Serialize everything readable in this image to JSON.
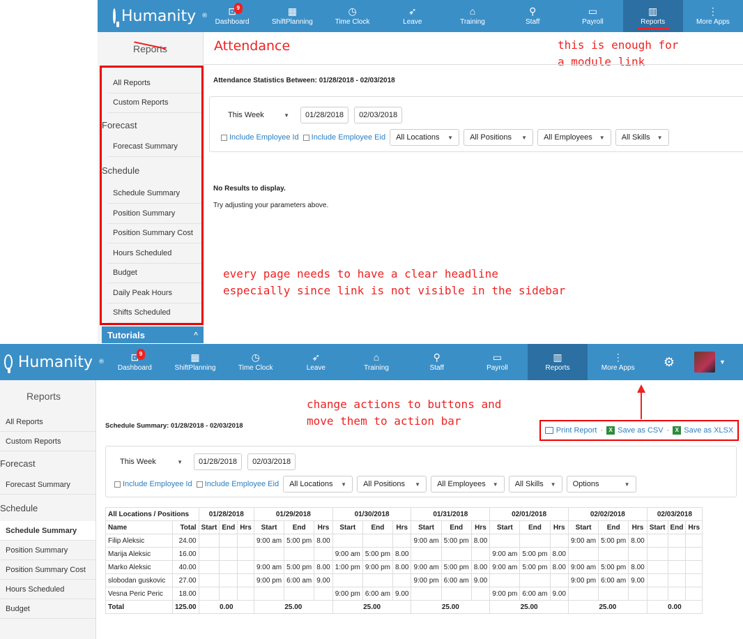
{
  "top": {
    "brand": "Humanity",
    "brand_mark": "®",
    "nav": [
      {
        "label": "Dashboard",
        "icon": "dashboard-icon",
        "glyph": "⊡",
        "badge": "9"
      },
      {
        "label": "ShiftPlanning",
        "icon": "grid-icon",
        "glyph": "▦"
      },
      {
        "label": "Time Clock",
        "icon": "clock-icon",
        "glyph": "◷"
      },
      {
        "label": "Leave",
        "icon": "rocket-icon",
        "glyph": "➶"
      },
      {
        "label": "Training",
        "icon": "graduation-cap-icon",
        "glyph": "⌂"
      },
      {
        "label": "Staff",
        "icon": "person-icon",
        "glyph": "⚲"
      },
      {
        "label": "Payroll",
        "icon": "wallet-icon",
        "glyph": "▭"
      },
      {
        "label": "Reports",
        "icon": "bar-chart-icon",
        "glyph": "▥"
      },
      {
        "label": "More Apps",
        "icon": "more-icon",
        "glyph": "⋮"
      }
    ],
    "sidebar_title": "Reports",
    "page_heading": "Attendance",
    "stats_label": "Attendance Statistics Between:  01/28/2018  -  02/03/2018",
    "range": "This Week",
    "date_from": "01/28/2018",
    "date_to": "02/03/2018",
    "chk_id": "Include Employee Id",
    "chk_eid": "Include Employee Eid",
    "filters": [
      "All Locations",
      "All Positions",
      "All Employees",
      "All Skills"
    ],
    "no_results": "No Results to display.",
    "hint": "Try adjusting your parameters above.",
    "sidebar_items": [
      "All Reports",
      "Custom Reports"
    ],
    "forecast": "Forecast",
    "forecast_items": [
      "Forecast Summary"
    ],
    "schedule": "Schedule",
    "schedule_items": [
      "Schedule Summary",
      "Position Summary",
      "Position Summary Cost",
      "Hours Scheduled",
      "Budget",
      "Daily Peak Hours",
      "Shifts Scheduled"
    ],
    "tutorials": "Tutorials",
    "note_module": [
      "this is enough for",
      "a module link"
    ],
    "note_headline": [
      "every page needs to have a clear headline",
      "especially since link is not visible in the sidebar"
    ]
  },
  "bottom": {
    "sidebar_title": "Reports",
    "sidebar_items": [
      "All Reports",
      "Custom Reports"
    ],
    "forecast": "Forecast",
    "forecast_items": [
      "Forecast Summary"
    ],
    "schedule": "Schedule",
    "schedule_items": [
      "Schedule Summary",
      "Position Summary",
      "Position Summary Cost",
      "Hours Scheduled",
      "Budget"
    ],
    "summary_label": "Schedule Summary:  01/28/2018  -  02/03/2018",
    "note_actions": [
      "change actions to buttons and",
      "move them to action bar"
    ],
    "actions": {
      "print": "Print Report",
      "csv": "Save as CSV",
      "xlsx": "Save as XLSX",
      "sep": "·"
    },
    "range": "This Week",
    "date_from": "01/28/2018",
    "date_to": "02/03/2018",
    "chk_id": "Include Employee Id",
    "chk_eid": "Include Employee Eid",
    "filters": [
      "All Locations",
      "All Positions",
      "All Employees",
      "All Skills",
      "Options"
    ],
    "table": {
      "corner": "All Locations / Positions",
      "dates": [
        "01/28/2018",
        "01/29/2018",
        "01/30/2018",
        "01/31/2018",
        "02/01/2018",
        "02/02/2018",
        "02/03/2018"
      ],
      "name_h": "Name",
      "total_h": "Total",
      "sub": [
        "Start",
        "End",
        "Hrs"
      ],
      "rows": [
        {
          "name": "Filip Aleksic",
          "total": "24.00",
          "days": [
            [
              "",
              "",
              ""
            ],
            [
              "9:00 am",
              "5:00 pm",
              "8.00"
            ],
            [
              "",
              "",
              ""
            ],
            [
              "9:00 am",
              "5:00 pm",
              "8.00"
            ],
            [
              "",
              "",
              ""
            ],
            [
              "9:00 am",
              "5:00 pm",
              "8.00"
            ],
            [
              "",
              "",
              ""
            ]
          ]
        },
        {
          "name": "Marija Aleksic",
          "total": "16.00",
          "days": [
            [
              "",
              "",
              ""
            ],
            [
              "",
              "",
              ""
            ],
            [
              "9:00 am",
              "5:00 pm",
              "8.00"
            ],
            [
              "",
              "",
              ""
            ],
            [
              "9:00 am",
              "5:00 pm",
              "8.00"
            ],
            [
              "",
              "",
              ""
            ],
            [
              "",
              "",
              ""
            ]
          ]
        },
        {
          "name": "Marko Aleksic",
          "total": "40.00",
          "days": [
            [
              "",
              "",
              ""
            ],
            [
              "9:00 am",
              "5:00 pm",
              "8.00"
            ],
            [
              "1:00 pm",
              "9:00 pm",
              "8.00"
            ],
            [
              "9:00 am",
              "5:00 pm",
              "8.00"
            ],
            [
              "9:00 am",
              "5:00 pm",
              "8.00"
            ],
            [
              "9:00 am",
              "5:00 pm",
              "8.00"
            ],
            [
              "",
              "",
              ""
            ]
          ]
        },
        {
          "name": "slobodan guskovic",
          "total": "27.00",
          "days": [
            [
              "",
              "",
              ""
            ],
            [
              "9:00 pm",
              "6:00 am",
              "9.00"
            ],
            [
              "",
              "",
              ""
            ],
            [
              "9:00 pm",
              "6:00 am",
              "9.00"
            ],
            [
              "",
              "",
              ""
            ],
            [
              "9:00 pm",
              "6:00 am",
              "9.00"
            ],
            [
              "",
              "",
              ""
            ]
          ]
        },
        {
          "name": "Vesna Peric Peric",
          "total": "18.00",
          "days": [
            [
              "",
              "",
              ""
            ],
            [
              "",
              "",
              ""
            ],
            [
              "9:00 pm",
              "6:00 am",
              "9.00"
            ],
            [
              "",
              "",
              ""
            ],
            [
              "9:00 pm",
              "6:00 am",
              "9.00"
            ],
            [
              "",
              "",
              ""
            ],
            [
              "",
              "",
              ""
            ]
          ]
        }
      ],
      "total_label": "Total",
      "grand_total": "125.00",
      "day_totals": [
        "0.00",
        "25.00",
        "25.00",
        "25.00",
        "25.00",
        "25.00",
        "0.00"
      ]
    }
  },
  "colors": {
    "nav": "#3b8fc7",
    "active": "#2b6fa3",
    "annotation": "#e22"
  }
}
